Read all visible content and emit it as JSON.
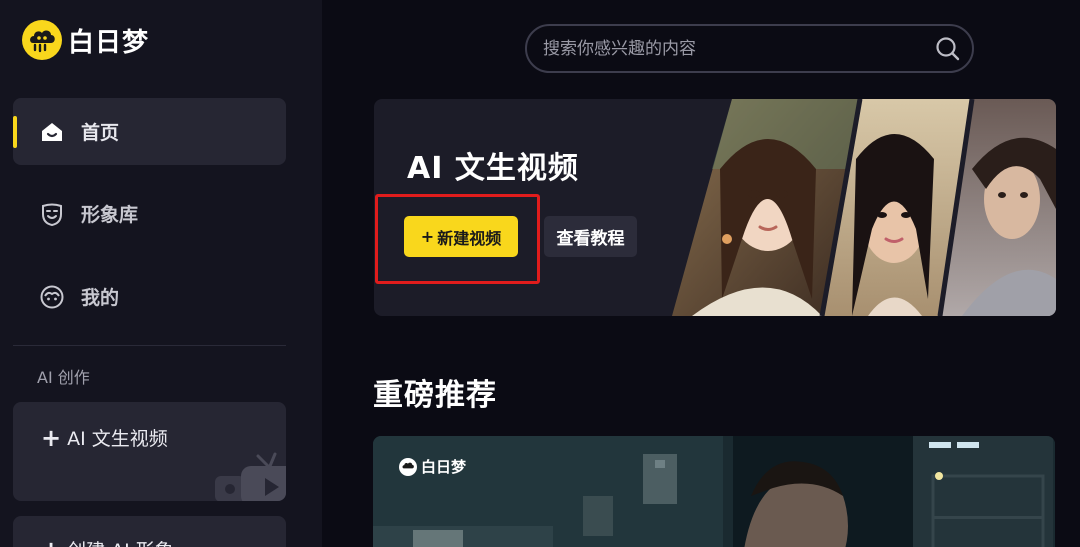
{
  "app": {
    "name": "白日梦"
  },
  "sidebar": {
    "items": [
      {
        "label": "首页",
        "icon": "home-icon",
        "active": true
      },
      {
        "label": "形象库",
        "icon": "mask-icon",
        "active": false
      },
      {
        "label": "我的",
        "icon": "face-icon",
        "active": false
      }
    ],
    "section_label": "AI 创作",
    "create_cards": [
      {
        "label": "AI 文生视频"
      },
      {
        "label": "创建 AI 形象"
      }
    ]
  },
  "search": {
    "placeholder": "搜索你感兴趣的内容"
  },
  "banner": {
    "title": "AI 文生视频",
    "new_button": "新建视频",
    "tutorial_button": "查看教程"
  },
  "section": {
    "title": "重磅推荐"
  },
  "feature": {
    "logo_text": "白日梦"
  },
  "colors": {
    "accent": "#f9d71c",
    "highlight": "#e01c1c",
    "sidebar_bg": "#14141f",
    "page_bg": "#0b0b14"
  }
}
